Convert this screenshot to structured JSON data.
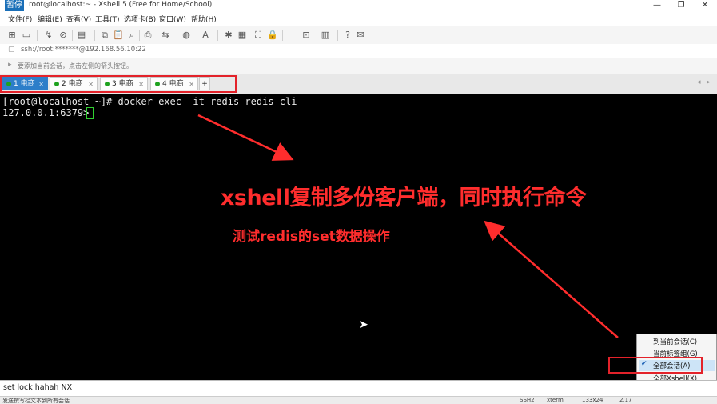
{
  "window": {
    "title": "root@localhost:~ - Xshell 5 (Free for Home/School)",
    "logo_text": "暂停",
    "controls": [
      "—",
      "❐",
      "✕"
    ]
  },
  "menu": [
    "文件(F)",
    "编辑(E)",
    "查看(V)",
    "工具(T)",
    "选项卡(B)",
    "窗口(W)",
    "帮助(H)"
  ],
  "address": "ssh://root:*******@192.168.56.10:22",
  "hint": "要添加当前会话，点击左侧的箭头按钮。",
  "tabs": [
    {
      "label": "1 电商",
      "active": true
    },
    {
      "label": "2 电商",
      "active": false
    },
    {
      "label": "3 电商",
      "active": false
    },
    {
      "label": "4 电商",
      "active": false
    }
  ],
  "new_tab": "+",
  "terminal": {
    "lines": [
      "[root@localhost ~]# docker exec -it redis redis-cli",
      "127.0.0.1:6379> "
    ]
  },
  "annotations": {
    "headline": "xshell复制多份客户端，同时执行命令",
    "subline": "测试redis的set数据操作"
  },
  "popup_menu": [
    {
      "label": "到当前会话(C)",
      "selected": false
    },
    {
      "label": "当前标签组(G)",
      "selected": false
    },
    {
      "label": "全部会话(A)",
      "selected": true
    },
    {
      "label": "全部Xshell(X)",
      "selected": false
    }
  ],
  "compose_text": "set lock hahah NX",
  "status": {
    "left": "发送撰写栏文本到所有会话",
    "protocol": "SSH2",
    "term": "xterm",
    "size": "133x24",
    "pos": "2,17"
  },
  "colors": {
    "accent": "#2d7ec9",
    "annotation_red": "#ff2d2d",
    "terminal_bg": "#000000"
  }
}
